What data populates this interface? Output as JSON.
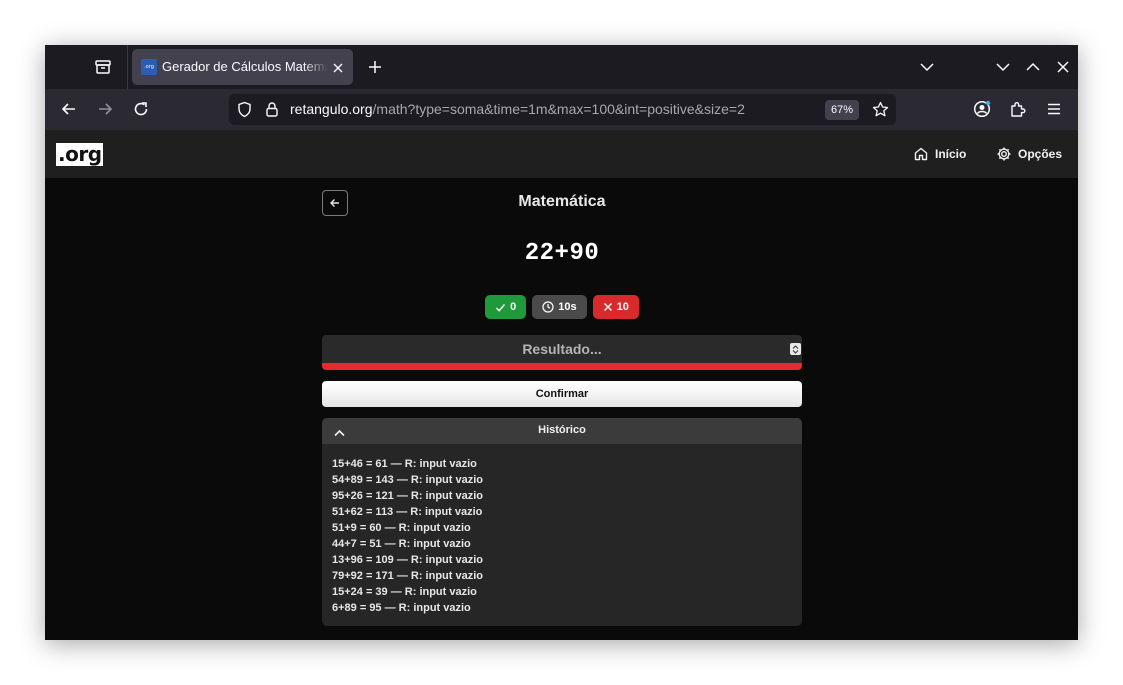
{
  "browser": {
    "tab": {
      "title": "Gerador de Cálculos Matemáticos",
      "favicon_text": ".org"
    },
    "url": {
      "host": "retangulo.org",
      "path": "/math?type=soma&time=1m&max=100&int=positive&size=2"
    },
    "zoom": "67%"
  },
  "site": {
    "logo": ".org",
    "nav": {
      "home_label": "Início",
      "options_label": "Opções"
    }
  },
  "page": {
    "title": "Matemática",
    "problem": "22+90",
    "stats": {
      "correct": "0",
      "time": "10s",
      "wrong": "10"
    },
    "answer": {
      "placeholder": "Resultado...",
      "value": ""
    },
    "confirm_label": "Confirmar",
    "history": {
      "title": "Histórico",
      "items": [
        "15+46 = 61 — R: input vazio",
        "54+89 = 143 — R: input vazio",
        "95+26 = 121 — R: input vazio",
        "51+62 = 113 — R: input vazio",
        "51+9 = 60 — R: input vazio",
        "44+7 = 51 — R: input vazio",
        "13+96 = 109 — R: input vazio",
        "79+92 = 171 — R: input vazio",
        "15+24 = 39 — R: input vazio",
        "6+89 = 95 — R: input vazio"
      ]
    }
  },
  "colors": {
    "correct_badge": "#1e9a3a",
    "time_badge": "#4a4a4a",
    "wrong_badge": "#d82a2a",
    "progress_bar": "#e52b2b",
    "page_bg": "#0a0a0a"
  },
  "icons": {
    "tab_archive": "archive-icon",
    "back": "arrow-left-icon",
    "forward": "arrow-right-icon",
    "reload": "reload-icon",
    "shield": "shield-icon",
    "lock": "lock-icon",
    "bookmark": "star-icon",
    "account": "account-icon",
    "extensions": "puzzle-icon",
    "menu": "hamburger-icon",
    "home": "home-icon",
    "options": "gear-icon",
    "check": "check-icon",
    "clock": "clock-icon",
    "x": "x-icon",
    "collapse": "chevron-up-icon"
  }
}
